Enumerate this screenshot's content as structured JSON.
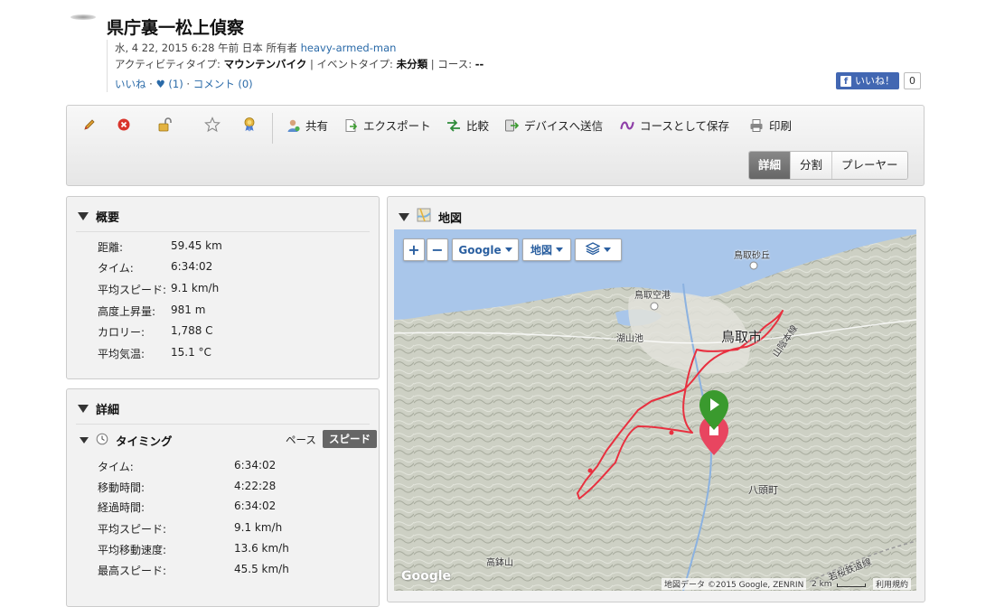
{
  "activity": {
    "title": "県庁裏一松上偵察",
    "date_line": "水, 4 22, 2015 6:28 午前 日本 所有者",
    "owner": "heavy-armed-man",
    "type_label": "アクティビティタイプ:",
    "type_value": "マウンテンバイク",
    "event_label": "| イベントタイプ:",
    "event_value": "未分類",
    "course_label": "| コース:",
    "course_value": "--",
    "like_link": "いいね",
    "hearts": "♥ (1)",
    "comment_link": "コメント (0)"
  },
  "facebook": {
    "label": "いいね！",
    "count": "0"
  },
  "toolbar": {
    "icons": [
      "pencil-icon",
      "delete-icon",
      "lock-icon",
      "star-icon",
      "ribbon-icon"
    ],
    "share": "共有",
    "export": "エクスポート",
    "compare": "比較",
    "send_device": "デバイスへ送信",
    "save_course": "コースとして保存",
    "print": "印刷",
    "views": [
      "詳細",
      "分割",
      "プレーヤー"
    ],
    "active_view": "詳細"
  },
  "summary": {
    "heading": "概要",
    "rows": [
      {
        "label": "距離:",
        "value": "59.45 km"
      },
      {
        "label": "タイム:",
        "value": "6:34:02"
      },
      {
        "label": "平均スピード:",
        "value": "9.1 km/h"
      },
      {
        "label": "高度上昇量:",
        "value": "981 m"
      },
      {
        "label": "カロリー:",
        "value": "1,788 C"
      },
      {
        "label": "平均気温:",
        "value": "15.1 °C"
      }
    ]
  },
  "details": {
    "heading": "詳細",
    "timing_heading": "タイミング",
    "pace_toggle": "ペース",
    "speed_toggle": "スピード",
    "rows": [
      {
        "label": "タイム:",
        "value": "6:34:02"
      },
      {
        "label": "移動時間:",
        "value": "4:22:28"
      },
      {
        "label": "経過時間:",
        "value": "6:34:02"
      },
      {
        "label": "平均スピード:",
        "value": "9.1 km/h"
      },
      {
        "label": "平均移動速度:",
        "value": "13.6 km/h"
      },
      {
        "label": "最高スピード:",
        "value": "45.5 km/h"
      }
    ]
  },
  "map": {
    "heading": "地図",
    "zoom_in": "+",
    "zoom_out": "−",
    "provider": "Google",
    "map_type": "地図",
    "labels": {
      "sakyu": "鳥取砂丘",
      "airport": "鳥取空港",
      "lake": "湖山池",
      "city": "鳥取市",
      "highway": "山陰本線",
      "yazu": "八頭町",
      "mountain": "高鉢山",
      "railway": "若桜鉄道線"
    },
    "google_logo": "Google",
    "attribution": "地図データ ©2015 Google, ZENRIN",
    "scale": "2 km",
    "terms": "利用規約"
  },
  "colors": {
    "route": "#e8303f",
    "start": "#3a9a2e",
    "end": "#e84560",
    "link": "#2a6aa8",
    "sea": "#a9c6ea"
  }
}
